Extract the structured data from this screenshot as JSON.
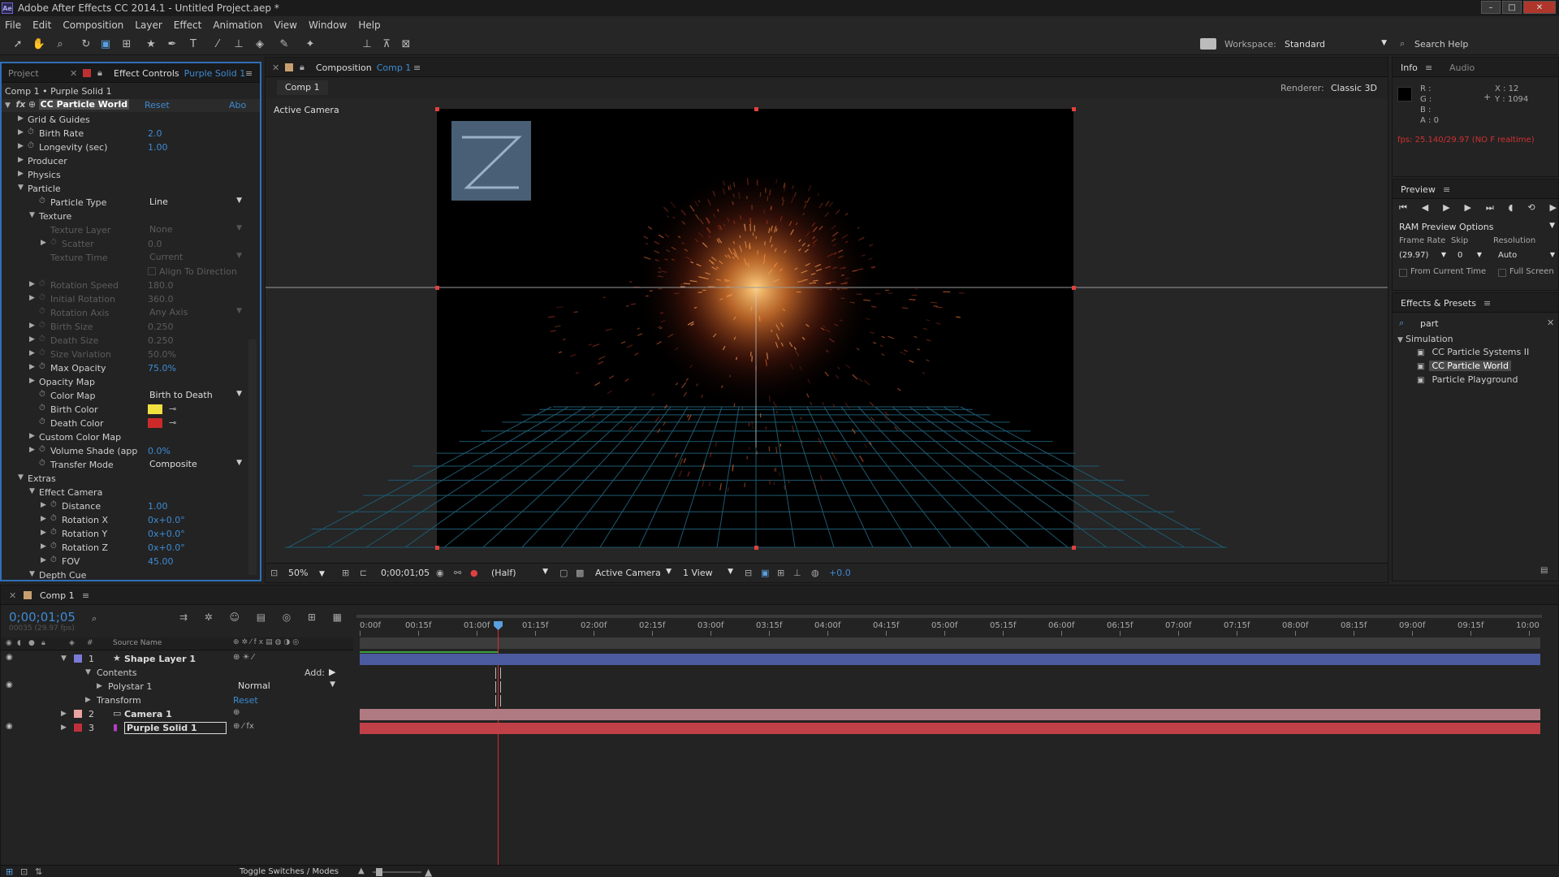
{
  "app": {
    "title": "Adobe After Effects CC 2014.1 - Untitled Project.aep *",
    "icon_text": "Ae"
  },
  "menu": [
    "File",
    "Edit",
    "Composition",
    "Layer",
    "Effect",
    "Animation",
    "View",
    "Window",
    "Help"
  ],
  "toolbar": {
    "workspace_label": "Workspace:",
    "workspace_value": "Standard",
    "search_placeholder": "Search Help"
  },
  "effect_controls": {
    "tab_project": "Project",
    "tab_label": "Effect Controls",
    "tab_target": "Purple Solid 1",
    "breadcrumb": "Comp 1 • Purple Solid 1",
    "effect_name": "CC Particle World",
    "reset": "Reset",
    "about": "Abo",
    "rows": [
      {
        "indent": 0,
        "tri": "▶",
        "sw": false,
        "label": "Grid & Guides",
        "value": "",
        "kind": "none",
        "disabled": false
      },
      {
        "indent": 0,
        "tri": "▶",
        "sw": true,
        "label": "Birth Rate",
        "value": "2.0",
        "kind": "num",
        "disabled": false
      },
      {
        "indent": 0,
        "tri": "▶",
        "sw": true,
        "label": "Longevity (sec)",
        "value": "1.00",
        "kind": "num",
        "disabled": false
      },
      {
        "indent": 0,
        "tri": "▶",
        "sw": false,
        "label": "Producer",
        "value": "",
        "kind": "none",
        "disabled": false
      },
      {
        "indent": 0,
        "tri": "▶",
        "sw": false,
        "label": "Physics",
        "value": "",
        "kind": "none",
        "disabled": false
      },
      {
        "indent": 0,
        "tri": "▼",
        "sw": false,
        "label": "Particle",
        "value": "",
        "kind": "none",
        "disabled": false
      },
      {
        "indent": 1,
        "tri": "",
        "sw": true,
        "label": "Particle Type",
        "value": "Line",
        "kind": "dropdown",
        "disabled": false
      },
      {
        "indent": 1,
        "tri": "▼",
        "sw": false,
        "label": "Texture",
        "value": "",
        "kind": "none",
        "disabled": false
      },
      {
        "indent": 2,
        "tri": "",
        "sw": false,
        "label": "Texture Layer",
        "value": "None",
        "kind": "dropdown",
        "disabled": true
      },
      {
        "indent": 2,
        "tri": "▶",
        "sw": true,
        "label": "Scatter",
        "value": "0.0",
        "kind": "num",
        "disabled": true
      },
      {
        "indent": 2,
        "tri": "",
        "sw": false,
        "label": "Texture Time",
        "value": "Current",
        "kind": "dropdown",
        "disabled": true
      },
      {
        "indent": 2,
        "tri": "",
        "sw": false,
        "label": "",
        "value": "Align To Direction",
        "kind": "checkbox",
        "disabled": true
      },
      {
        "indent": 1,
        "tri": "▶",
        "sw": true,
        "label": "Rotation Speed",
        "value": "180.0",
        "kind": "num",
        "disabled": true
      },
      {
        "indent": 1,
        "tri": "▶",
        "sw": true,
        "label": "Initial Rotation",
        "value": "360.0",
        "kind": "num",
        "disabled": true
      },
      {
        "indent": 1,
        "tri": "",
        "sw": true,
        "label": "Rotation Axis",
        "value": "Any Axis",
        "kind": "dropdown",
        "disabled": true
      },
      {
        "indent": 1,
        "tri": "▶",
        "sw": true,
        "label": "Birth Size",
        "value": "0.250",
        "kind": "num",
        "disabled": true
      },
      {
        "indent": 1,
        "tri": "▶",
        "sw": true,
        "label": "Death Size",
        "value": "0.250",
        "kind": "num",
        "disabled": true
      },
      {
        "indent": 1,
        "tri": "▶",
        "sw": true,
        "label": "Size Variation",
        "value": "50.0%",
        "kind": "num",
        "disabled": true
      },
      {
        "indent": 1,
        "tri": "▶",
        "sw": true,
        "label": "Max Opacity",
        "value": "75.0%",
        "kind": "num",
        "disabled": false
      },
      {
        "indent": 1,
        "tri": "▶",
        "sw": false,
        "label": "Opacity Map",
        "value": "",
        "kind": "none",
        "disabled": false
      },
      {
        "indent": 1,
        "tri": "",
        "sw": true,
        "label": "Color Map",
        "value": "Birth to Death",
        "kind": "dropdown",
        "disabled": false
      },
      {
        "indent": 1,
        "tri": "",
        "sw": true,
        "label": "Birth Color",
        "value": "#f0e040",
        "kind": "color",
        "disabled": false
      },
      {
        "indent": 1,
        "tri": "",
        "sw": true,
        "label": "Death Color",
        "value": "#cc2a2a",
        "kind": "color",
        "disabled": false
      },
      {
        "indent": 1,
        "tri": "▶",
        "sw": false,
        "label": "Custom Color Map",
        "value": "",
        "kind": "none",
        "disabled": false
      },
      {
        "indent": 1,
        "tri": "▶",
        "sw": true,
        "label": "Volume Shade (app",
        "value": "0.0%",
        "kind": "num",
        "disabled": false
      },
      {
        "indent": 1,
        "tri": "",
        "sw": true,
        "label": "Transfer Mode",
        "value": "Composite",
        "kind": "dropdown",
        "disabled": false
      },
      {
        "indent": 0,
        "tri": "▼",
        "sw": false,
        "label": "Extras",
        "value": "",
        "kind": "none",
        "disabled": false
      },
      {
        "indent": 1,
        "tri": "▼",
        "sw": false,
        "label": "Effect Camera",
        "value": "",
        "kind": "none",
        "disabled": false
      },
      {
        "indent": 2,
        "tri": "▶",
        "sw": true,
        "label": "Distance",
        "value": "1.00",
        "kind": "num",
        "disabled": false
      },
      {
        "indent": 2,
        "tri": "▶",
        "sw": true,
        "label": "Rotation X",
        "value": "0x+0.0°",
        "kind": "num",
        "disabled": false
      },
      {
        "indent": 2,
        "tri": "▶",
        "sw": true,
        "label": "Rotation Y",
        "value": "0x+0.0°",
        "kind": "num",
        "disabled": false
      },
      {
        "indent": 2,
        "tri": "▶",
        "sw": true,
        "label": "Rotation Z",
        "value": "0x+0.0°",
        "kind": "num",
        "disabled": false
      },
      {
        "indent": 2,
        "tri": "▶",
        "sw": true,
        "label": "FOV",
        "value": "45.00",
        "kind": "num",
        "disabled": false
      },
      {
        "indent": 1,
        "tri": "▼",
        "sw": false,
        "label": "Depth Cue",
        "value": "",
        "kind": "none",
        "disabled": false
      }
    ]
  },
  "composition": {
    "tab_label": "Composition",
    "tab_target": "Comp 1",
    "subtab": "Comp 1",
    "renderer_label": "Renderer:",
    "renderer_value": "Classic 3D",
    "view_label": "Active Camera",
    "footer": {
      "zoom": "50%",
      "timecode": "0;00;01;05",
      "resolution": "(Half)",
      "camera": "Active Camera",
      "views": "1 View",
      "exposure": "+0.0"
    }
  },
  "info": {
    "tab_info": "Info",
    "tab_audio": "Audio",
    "r": "R :",
    "g": "G :",
    "b": "B :",
    "a": "A : 0",
    "x": "X : 12",
    "y": "Y : 1094",
    "fps": "fps: 25.140/29.97 (NO F realtime)"
  },
  "preview": {
    "tab": "Preview",
    "ram_options": "RAM Preview Options",
    "frame_rate_label": "Frame Rate",
    "skip_label": "Skip",
    "resolution_label": "Resolution",
    "frame_rate": "(29.97)",
    "skip": "0",
    "resolution": "Auto",
    "from_current": "From Current Time",
    "full_screen": "Full Screen"
  },
  "effects_presets": {
    "tab": "Effects & Presets",
    "search": "part",
    "category": "Simulation",
    "items": [
      "CC Particle Systems II",
      "CC Particle World",
      "Particle Playground"
    ],
    "selected_index": 1
  },
  "timeline": {
    "tab": "Comp 1",
    "timecode": "0;00;01;05",
    "timecode_sub": "00035 (29.97 fps)",
    "source_name_header": "Source Name",
    "add_label": "Add:",
    "toggle_label": "Toggle Switches / Modes",
    "ruler": [
      "0:00f",
      "00:15f",
      "01:00f",
      "01:15f",
      "02:00f",
      "02:15f",
      "03:00f",
      "03:15f",
      "04:00f",
      "04:15f",
      "05:00f",
      "05:15f",
      "06:00f",
      "06:15f",
      "07:00f",
      "07:15f",
      "08:00f",
      "08:15f",
      "09:00f",
      "09:15f",
      "10:00"
    ],
    "current_time_fraction": 0.117,
    "layers": [
      {
        "kind": "layer",
        "num": "1",
        "name": "Shape Layer 1",
        "color": "#7a7ad8",
        "bar": "#4c5aa0",
        "indent": 0
      },
      {
        "kind": "sub",
        "name": "Contents",
        "indent": 1
      },
      {
        "kind": "sub",
        "name": "Polystar 1",
        "indent": 2,
        "mode": "Normal"
      },
      {
        "kind": "sub",
        "name": "Transform",
        "indent": 1,
        "reset": "Reset"
      },
      {
        "kind": "layer",
        "num": "2",
        "name": "Camera 1",
        "color": "#e8a3a3",
        "bar": "#b07a82",
        "indent": 0
      },
      {
        "kind": "layer",
        "num": "3",
        "name": "Purple Solid 1",
        "color": "#c0303a",
        "bar": "#c04048",
        "indent": 0
      }
    ]
  }
}
